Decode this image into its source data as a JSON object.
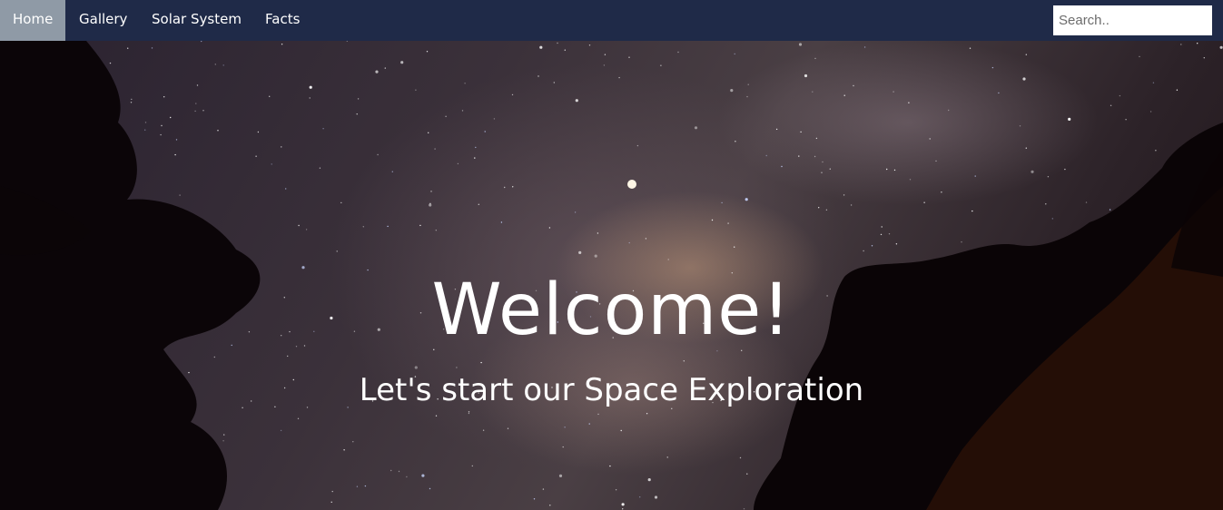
{
  "nav": {
    "items": [
      {
        "label": "Home",
        "active": true
      },
      {
        "label": "Gallery",
        "active": false
      },
      {
        "label": "Solar System",
        "active": false
      },
      {
        "label": "Facts",
        "active": false
      }
    ],
    "search_placeholder": "Search.."
  },
  "hero": {
    "title": "Welcome!",
    "subtitle": "Let's start our Space Exploration",
    "background_image": "milky-way-night-sky-with-tree-silhouettes"
  },
  "colors": {
    "navbar": "#1f2a48",
    "active_tab": "#8f9aa6",
    "text": "#ffffff"
  }
}
